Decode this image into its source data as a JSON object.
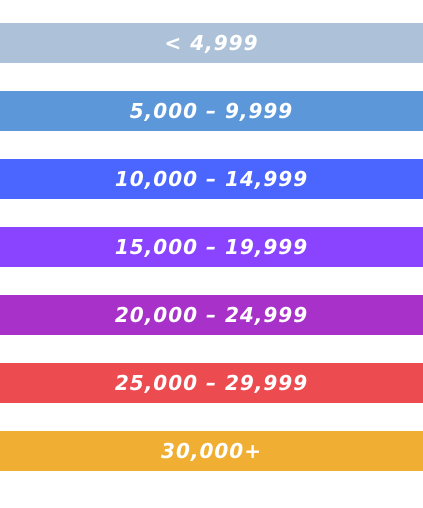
{
  "legend": {
    "bands": [
      {
        "label": "< 4,999",
        "color": "#adc2d8"
      },
      {
        "label": "5,000 – 9,999",
        "color": "#5b97d9"
      },
      {
        "label": "10,000 – 14,999",
        "color": "#4a66ff"
      },
      {
        "label": "15,000 – 19,999",
        "color": "#8a44ff"
      },
      {
        "label": "20,000 – 24,999",
        "color": "#a731c9"
      },
      {
        "label": "25,000 – 29,999",
        "color": "#ec4c50"
      },
      {
        "label": "30,000+",
        "color": "#f0ae33"
      }
    ]
  }
}
